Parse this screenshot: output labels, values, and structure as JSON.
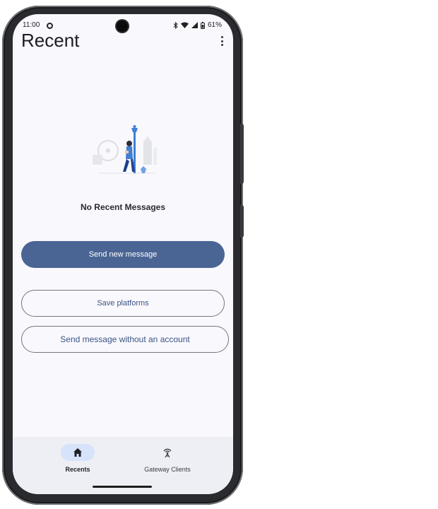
{
  "status_bar": {
    "time": "11:00",
    "battery": "61%"
  },
  "header": {
    "title": "Recent"
  },
  "empty_state": {
    "message": "No Recent Messages"
  },
  "actions": {
    "send_new": "Send new message",
    "save_platforms": "Save platforms",
    "send_without_account": "Send message without an account"
  },
  "bottom_nav": {
    "items": [
      {
        "label": "Recents",
        "icon": "home-icon",
        "active": true
      },
      {
        "label": "Gateway Clients",
        "icon": "antenna-icon",
        "active": false
      }
    ]
  },
  "colors": {
    "primary": "#4a6594",
    "primary_text": "#3b5483",
    "nav_active_pill": "#d7e2fb",
    "screen_bg": "#f9f8fd"
  }
}
